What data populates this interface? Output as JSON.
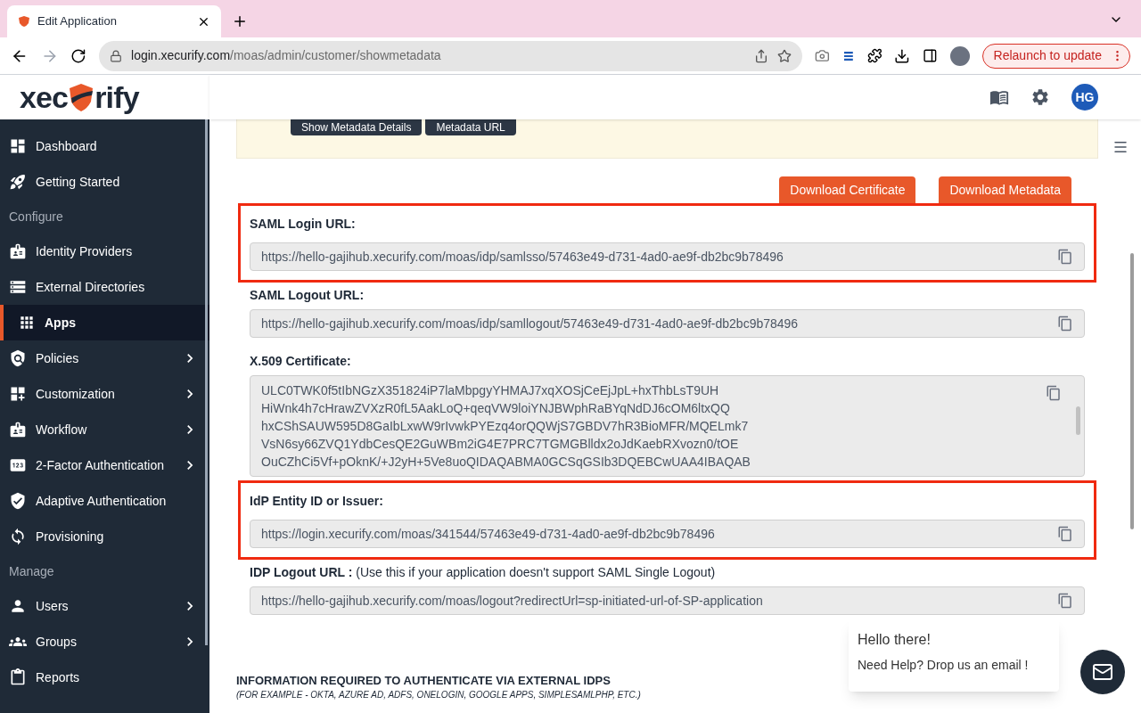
{
  "browser": {
    "tab_title": "Edit Application",
    "url_host": "login.xecurify.com",
    "url_path": "/moas/admin/customer/showmetadata",
    "relaunch": "Relaunch to update"
  },
  "header": {
    "logo_before": "xec",
    "logo_after": "rify",
    "avatar": "HG"
  },
  "sidebar": [
    {
      "kind": "item",
      "label": "Dashboard",
      "selected": false,
      "expandable": false
    },
    {
      "kind": "item",
      "label": "Getting Started",
      "selected": false,
      "expandable": false
    },
    {
      "kind": "section",
      "label": "Configure"
    },
    {
      "kind": "item",
      "label": "Identity Providers",
      "selected": false,
      "expandable": false
    },
    {
      "kind": "item",
      "label": "External Directories",
      "selected": false,
      "expandable": false
    },
    {
      "kind": "item",
      "label": "Apps",
      "selected": true,
      "expandable": false
    },
    {
      "kind": "item",
      "label": "Policies",
      "selected": false,
      "expandable": true
    },
    {
      "kind": "item",
      "label": "Customization",
      "selected": false,
      "expandable": true
    },
    {
      "kind": "item",
      "label": "Workflow",
      "selected": false,
      "expandable": true
    },
    {
      "kind": "item",
      "label": "2-Factor Authentication",
      "selected": false,
      "expandable": true
    },
    {
      "kind": "item",
      "label": "Adaptive Authentication",
      "selected": false,
      "expandable": false
    },
    {
      "kind": "item",
      "label": "Provisioning",
      "selected": false,
      "expandable": false
    },
    {
      "kind": "section",
      "label": "Manage"
    },
    {
      "kind": "item",
      "label": "Users",
      "selected": false,
      "expandable": true
    },
    {
      "kind": "item",
      "label": "Groups",
      "selected": false,
      "expandable": true
    },
    {
      "kind": "item",
      "label": "Reports",
      "selected": false,
      "expandable": false
    }
  ],
  "metadata_buttons": [
    "Show Metadata Details",
    "Metadata URL"
  ],
  "download_buttons": [
    "Download Certificate",
    "Download Metadata"
  ],
  "fields": [
    {
      "kind": "input",
      "label": "SAML Login URL:",
      "highlighted": true,
      "value": "https://hello-gajihub.xecurify.com/moas/idp/samlsso/57463e49-d731-4ad0-ae9f-db2bc9b78496"
    },
    {
      "kind": "input",
      "label": "SAML Logout URL:",
      "highlighted": false,
      "value": "https://hello-gajihub.xecurify.com/moas/idp/samllogout/57463e49-d731-4ad0-ae9f-db2bc9b78496"
    },
    {
      "kind": "textarea",
      "label": "X.509 Certificate:",
      "highlighted": false,
      "lines": [
        "ULC0TWK0f5tIbNGzX351824iP7laMbpgyYHMAJ7xqXOSjCeEjJpL+hxThbLsT9UH",
        "HiWnk4h7cHrawZVXzR0fL5AakLoQ+qeqVW9loiYNJBWphRaBYqNdDJ6cOM6ltxQQ",
        "hxCShSAUW595D8GaIbLxwW9rIvwkPYEzq4orQQWjS7GBDV7hR3BioMFR/MQELmk7",
        "VsN6sy66ZVQ1YdbCesQE2GuWBm2iG4E7PRC7TGMGBlldx2oJdKaebRXvozn0/tOE",
        "OuCZhCi5Vf+pOknK/+J2yH+5Ve8uoQIDAQABMA0GCSqGSIb3DQEBCwUAA4IBAQAB"
      ]
    },
    {
      "kind": "input",
      "label": "IdP Entity ID or Issuer:",
      "highlighted": true,
      "value": "https://login.xecurify.com/moas/341544/57463e49-d731-4ad0-ae9f-db2bc9b78496"
    },
    {
      "kind": "input",
      "label": "**IDP Logout URL :** (Use this if your application doesn't support SAML Single Logout)",
      "highlighted": false,
      "value": "https://hello-gajihub.xecurify.com/moas/logout?redirectUrl=sp-initiated-url-of-SP-application"
    }
  ],
  "info": {
    "title": "INFORMATION REQUIRED TO AUTHENTICATE VIA EXTERNAL IDPS",
    "subtitle": "(FOR EXAMPLE - OKTA, AZURE AD, ADFS, ONELOGIN, GOOGLE APPS, SIMPLESAMLPHP, ETC.)"
  },
  "chat": {
    "greeting": "Hello there!",
    "message": "Need Help? Drop us an email !"
  }
}
